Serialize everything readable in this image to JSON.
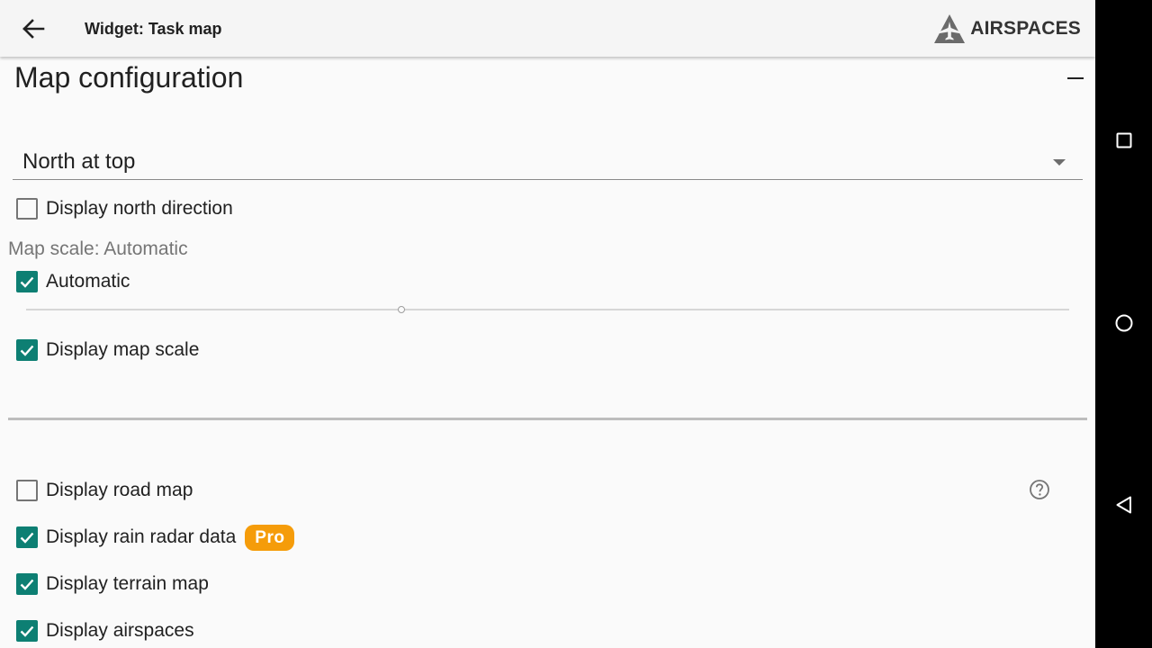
{
  "toolbar": {
    "title": "Widget: Task map",
    "brand_text": "AIRSPACES"
  },
  "section": {
    "title": "Map configuration"
  },
  "orientation_select": {
    "value": "North at top"
  },
  "options": {
    "display_north_direction": {
      "label": "Display north direction",
      "checked": false
    },
    "map_scale_caption": "Map scale: Automatic",
    "automatic": {
      "label": "Automatic",
      "checked": true
    },
    "scale_slider_fraction": 0.36,
    "display_map_scale": {
      "label": "Display map scale",
      "checked": true
    },
    "display_road_map": {
      "label": "Display road map",
      "checked": false
    },
    "display_rain_radar": {
      "label": "Display rain radar data",
      "checked": true,
      "badge": "Pro"
    },
    "display_terrain_map": {
      "label": "Display terrain map",
      "checked": true
    },
    "display_airspaces": {
      "label": "Display airspaces",
      "checked": true
    }
  },
  "colors": {
    "accent": "#0d7f73",
    "pro_badge": "#f59c0a",
    "navbar": "#000000"
  },
  "icons": {
    "back": "arrow-back-icon",
    "brand": "airspaces-logo-icon",
    "collapse": "minus-icon",
    "dropdown": "triangle-down-icon",
    "help": "help-circle-icon",
    "nav_recents": "square-icon",
    "nav_home": "circle-icon",
    "nav_back": "triangle-back-icon"
  }
}
